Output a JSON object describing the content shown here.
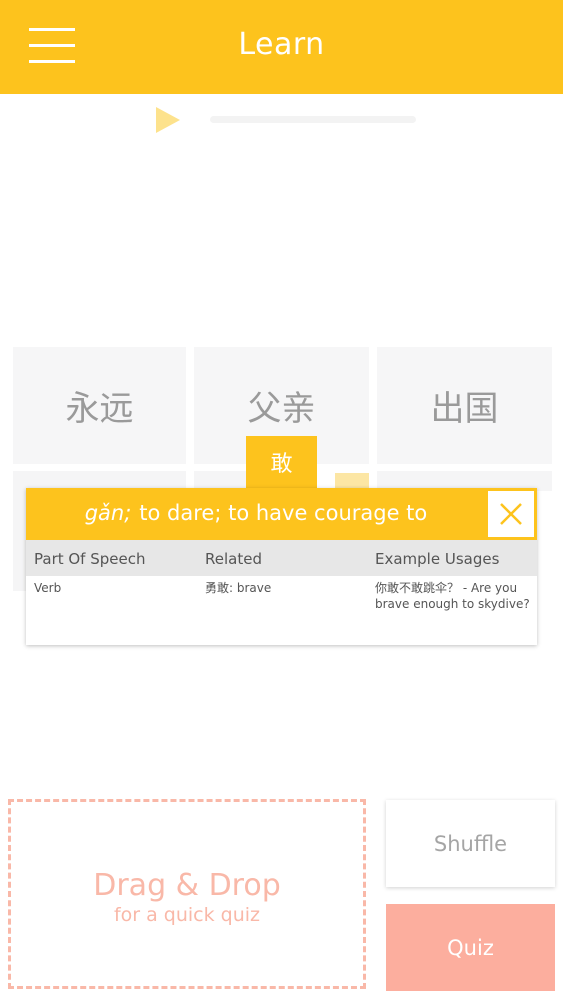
{
  "app_bar": {
    "title": "Learn",
    "menu_icon": "hamburger-menu-icon",
    "color": "#FDC31D"
  },
  "audio": {
    "play_icon": "play-icon",
    "progress": 0
  },
  "tiles": [
    "永远",
    "父亲",
    "出国"
  ],
  "popup": {
    "character": "敢",
    "pinyin": "gǎn;",
    "definition": "to dare; to have courage to",
    "close_icon": "close-x-icon",
    "columns": [
      {
        "header": "Part Of Speech",
        "value": "Verb"
      },
      {
        "header": "Related",
        "value": "勇敢: brave"
      },
      {
        "header": "Example Usages",
        "value": "你敢不敢跳伞？ - Are you brave enough to skydive?"
      }
    ]
  },
  "quiz": {
    "drop_title": "Drag & Drop",
    "drop_subtitle": "for a quick quiz",
    "shuffle_label": "Shuffle",
    "quiz_label": "Quiz",
    "accent": "#FCAE9E"
  }
}
